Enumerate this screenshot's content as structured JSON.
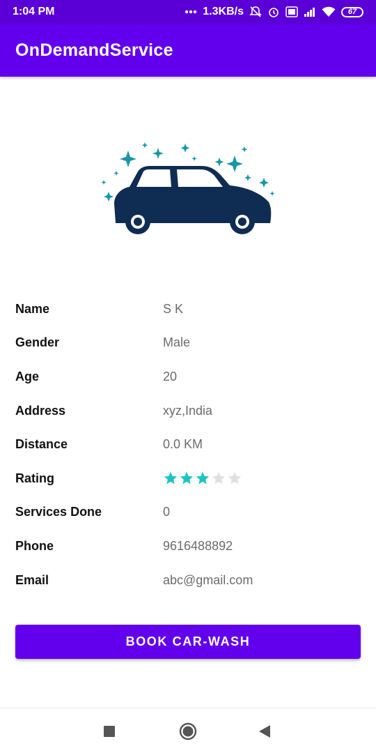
{
  "status_bar": {
    "time": "1:04 PM",
    "network_speed": "1.3KB/s",
    "battery_level": "67",
    "icons": [
      "dots-icon",
      "mute-icon",
      "alarm-icon",
      "volte-icon",
      "signal-icon",
      "wifi-icon",
      "battery-icon"
    ]
  },
  "app_bar": {
    "title": "OnDemandService"
  },
  "colors": {
    "primary": "#6200ee",
    "status_bar": "#5a00d6",
    "star_filled": "#1dc4c4",
    "star_empty": "#e0e0e0",
    "car": "#0f2d52",
    "sparkle": "#1597a7"
  },
  "details": [
    {
      "label": "Name",
      "value": "S K"
    },
    {
      "label": "Gender",
      "value": "Male"
    },
    {
      "label": "Age",
      "value": "20"
    },
    {
      "label": "Address",
      "value": "xyz,India"
    },
    {
      "label": "Distance",
      "value": "0.0 KM"
    },
    {
      "label": "Rating",
      "rating": 3,
      "max_rating": 5
    },
    {
      "label": "Services Done",
      "value": "0"
    },
    {
      "label": "Phone",
      "value": "9616488892"
    },
    {
      "label": "Email",
      "value": "abc@gmail.com"
    }
  ],
  "button": {
    "label": "BOOK CAR-WASH"
  },
  "nav_bar": {
    "icons": [
      "recent-apps-icon",
      "home-icon",
      "back-icon"
    ]
  }
}
